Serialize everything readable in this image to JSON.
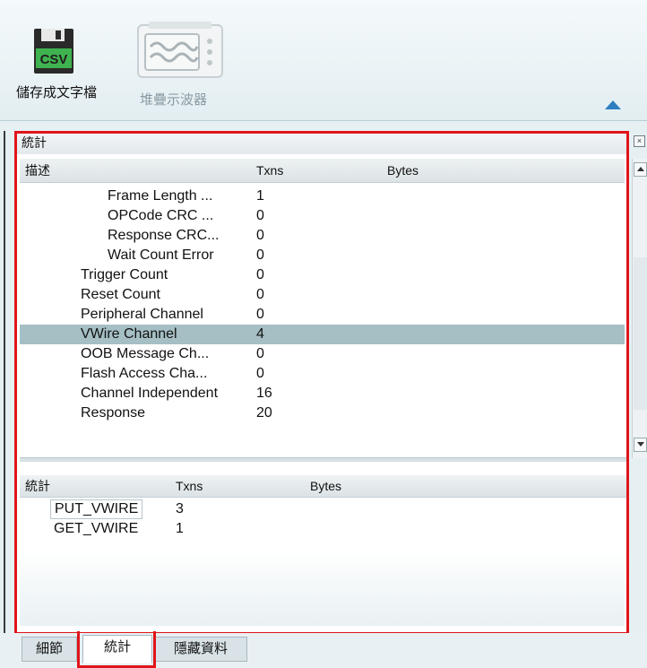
{
  "ribbon": {
    "save_label": "儲存成文字檔",
    "scope_label": "堆疊示波器",
    "save_icon_text": "CSV",
    "icons": {
      "save": "save-csv-icon",
      "scope": "oscilloscope-icon",
      "collapse": "chevron-up-icon"
    }
  },
  "panel": {
    "title": "統計"
  },
  "table1": {
    "columns": [
      "描述",
      "Txns",
      "Bytes"
    ],
    "rows": [
      {
        "desc": "Frame Length ...",
        "txns": "1"
      },
      {
        "desc": "OPCode CRC ...",
        "txns": "0"
      },
      {
        "desc": "Response CRC...",
        "txns": "0"
      },
      {
        "desc": "Wait Count Error",
        "txns": "0"
      },
      {
        "desc": "Trigger Count",
        "txns": "0"
      },
      {
        "desc": "Reset Count",
        "txns": "0"
      },
      {
        "desc": "Peripheral Channel",
        "txns": "0"
      },
      {
        "desc": "VWire Channel",
        "txns": "4"
      },
      {
        "desc": "OOB Message Ch...",
        "txns": "0"
      },
      {
        "desc": "Flash Access Cha...",
        "txns": "0"
      },
      {
        "desc": "Channel Independent",
        "txns": "16"
      },
      {
        "desc": "Response",
        "txns": "20"
      }
    ]
  },
  "table2": {
    "columns": [
      "統計",
      "Txns",
      "Bytes"
    ],
    "rows": [
      {
        "name": "PUT_VWIRE",
        "txns": "3"
      },
      {
        "name": "GET_VWIRE",
        "txns": "1"
      }
    ]
  },
  "tabs": [
    {
      "label": "細節"
    },
    {
      "label": "統計"
    },
    {
      "label": "隱藏資料"
    }
  ],
  "colors": {
    "highlight": "#e0151b",
    "selected_row": "#a5bfc4",
    "accent": "#2f7fc0"
  }
}
